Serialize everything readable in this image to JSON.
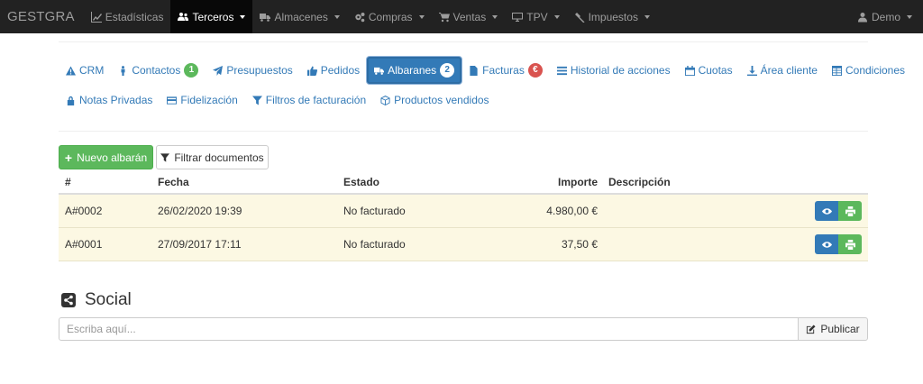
{
  "navbar": {
    "brand": "GESTGRA",
    "items": [
      {
        "label": "Estadísticas",
        "icon": "line-chart-icon",
        "caret": false,
        "active": false
      },
      {
        "label": "Terceros",
        "icon": "users-icon",
        "caret": true,
        "active": true
      },
      {
        "label": "Almacenes",
        "icon": "truck-icon",
        "caret": true,
        "active": false
      },
      {
        "label": "Compras",
        "icon": "cogs-icon",
        "caret": true,
        "active": false
      },
      {
        "label": "Ventas",
        "icon": "cart-icon",
        "caret": true,
        "active": false
      },
      {
        "label": "TPV",
        "icon": "desktop-icon",
        "caret": true,
        "active": false
      },
      {
        "label": "Impuestos",
        "icon": "gavel-icon",
        "caret": true,
        "active": false
      }
    ],
    "user": {
      "label": "Demo",
      "icon": "user-icon"
    }
  },
  "tabs": {
    "row1": [
      {
        "label": "CRM",
        "icon": "warning-icon"
      },
      {
        "label": "Contactos",
        "icon": "male-icon",
        "badge": "1",
        "badge_color": "#5cb85c"
      },
      {
        "label": "Presupuestos",
        "icon": "send-icon"
      },
      {
        "label": "Pedidos",
        "icon": "thumbs-up-icon"
      },
      {
        "label": "Albaranes",
        "icon": "truck-icon",
        "badge": "2",
        "badge_color": "#ffffff",
        "active": true
      },
      {
        "label": "Facturas",
        "icon": "file-icon",
        "badge": "€",
        "badge_color": "#d9534f"
      },
      {
        "label": "Historial de acciones",
        "icon": "list-icon"
      },
      {
        "label": "Cuotas",
        "icon": "calendar-icon"
      },
      {
        "label": "Área cliente",
        "icon": "download-icon"
      },
      {
        "label": "Condiciones",
        "icon": "table-icon"
      }
    ],
    "row2": [
      {
        "label": "Notas Privadas",
        "icon": "lock-icon"
      },
      {
        "label": "Fidelización",
        "icon": "credit-card-icon"
      },
      {
        "label": "Filtros de facturación",
        "icon": "filter-icon"
      },
      {
        "label": "Productos vendidos",
        "icon": "cube-icon"
      }
    ]
  },
  "actions": {
    "new_label": "Nuevo albarán",
    "filter_label": "Filtrar documentos"
  },
  "table": {
    "headers": {
      "num": "#",
      "fecha": "Fecha",
      "estado": "Estado",
      "importe": "Importe",
      "descripcion": "Descripción"
    },
    "rows": [
      {
        "num": "A#0002",
        "fecha": "26/02/2020 19:39",
        "estado": "No facturado",
        "importe": "4.980,00 €",
        "descripcion": ""
      },
      {
        "num": "A#0001",
        "fecha": "27/09/2017 17:11",
        "estado": "No facturado",
        "importe": "37,50 €",
        "descripcion": ""
      }
    ],
    "row_color": "#fcf8e3"
  },
  "social": {
    "title": "Social",
    "placeholder": "Escriba aquí...",
    "publish_label": "Publicar"
  },
  "colors": {
    "primary": "#337ab7",
    "success": "#5cb85c",
    "danger": "#d9534f",
    "navbar": "#222222"
  }
}
